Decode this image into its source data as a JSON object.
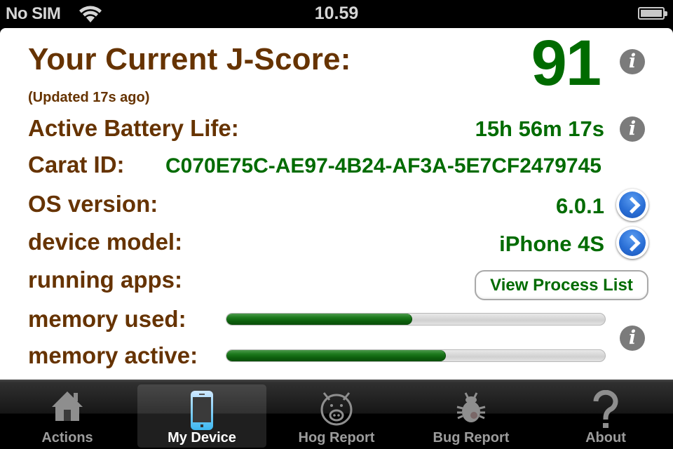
{
  "status_bar": {
    "carrier": "No SIM",
    "time": "10.59",
    "wifi_icon": "wifi-icon",
    "battery_icon": "battery-full-icon"
  },
  "jscore": {
    "title": "Your Current J-Score:",
    "updated": "(Updated 17s ago)",
    "value": "91",
    "info_icon": "info-icon"
  },
  "rows": {
    "battery": {
      "label": "Active Battery Life:",
      "value": "15h 56m 17s"
    },
    "carat_id": {
      "label": "Carat ID:",
      "value": "C070E75C-AE97-4B24-AF3A-5E7CF2479745"
    },
    "os_version": {
      "label": "OS version:",
      "value": "6.0.1"
    },
    "device_model": {
      "label": "device model:",
      "value": "iPhone 4S"
    },
    "running_apps": {
      "label": "running apps:",
      "button": "View Process List"
    },
    "memory_used": {
      "label": "memory used:",
      "fraction": 0.49
    },
    "memory_active": {
      "label": "memory active:",
      "fraction": 0.58
    }
  },
  "info_glyph": "i",
  "colors": {
    "label_brown": "#663300",
    "value_green": "#006b00",
    "disclosure_blue": "#2a6fd6"
  },
  "tabs": [
    {
      "label": "Actions",
      "icon": "house-icon",
      "active": false
    },
    {
      "label": "My Device",
      "icon": "iphone-icon",
      "active": true
    },
    {
      "label": "Hog Report",
      "icon": "pig-icon",
      "active": false
    },
    {
      "label": "Bug Report",
      "icon": "bug-icon",
      "active": false
    },
    {
      "label": "About",
      "icon": "question-mark-icon",
      "active": false
    }
  ]
}
